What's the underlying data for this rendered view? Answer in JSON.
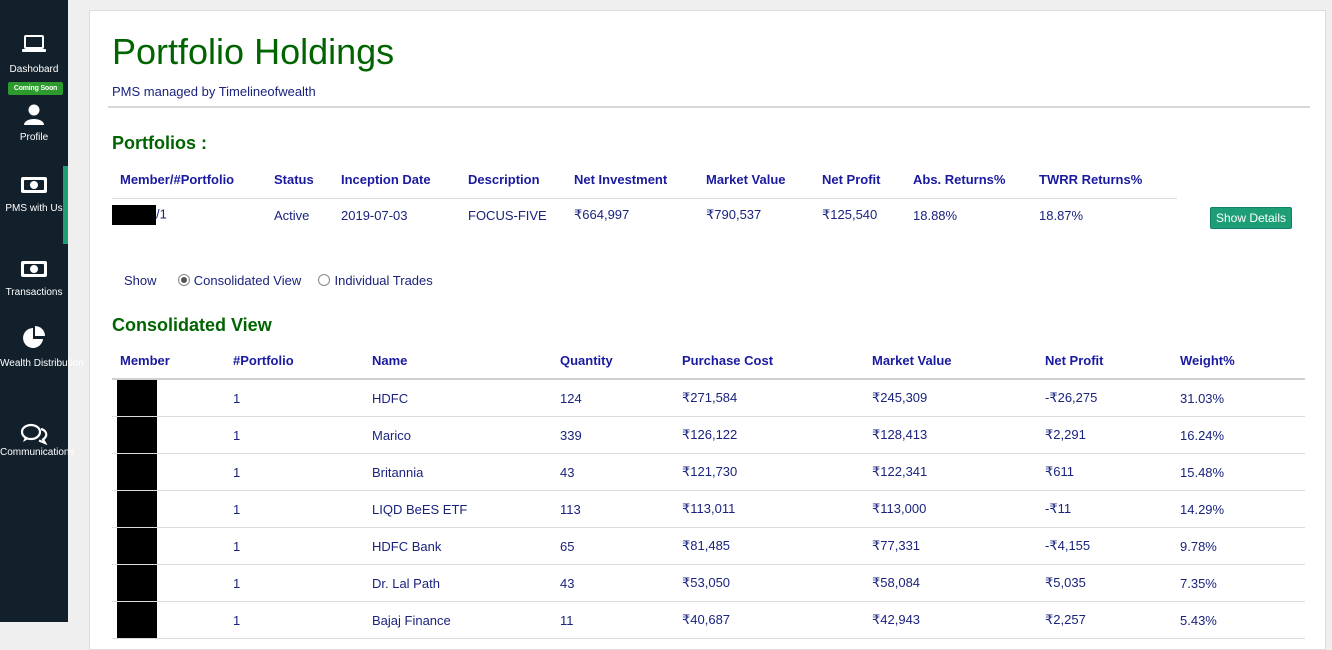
{
  "sidebar": {
    "items": [
      {
        "label": "Dashobard",
        "icon": "laptop-icon"
      },
      {
        "label": "Profile",
        "icon": "user-icon"
      },
      {
        "label": "PMS with Us",
        "icon": "money-icon"
      },
      {
        "label": "Transactions",
        "icon": "money-icon"
      },
      {
        "label": "Wealth Distribution",
        "icon": "pie-chart-icon"
      },
      {
        "label": "Communications",
        "icon": "chat-icon"
      }
    ],
    "badge": "Coming Soon"
  },
  "page": {
    "title": "Portfolio Holdings",
    "subtitle": "PMS managed by Timelineofwealth"
  },
  "portfolios": {
    "heading": "Portfolios :",
    "headers": [
      "Member/#Portfolio",
      "Status",
      "Inception Date",
      "Description",
      "Net Investment",
      "Market Value",
      "Net Profit",
      "Abs. Returns%",
      "TWRR Returns%"
    ],
    "row": {
      "member_suffix": "/1",
      "status": "Active",
      "inception": "2019-07-03",
      "description": "FOCUS-FIVE",
      "net_investment": "₹664,997",
      "market_value": "₹790,537",
      "net_profit": "₹125,540",
      "abs_returns": "18.88%",
      "twrr_returns": "18.87%"
    },
    "button": "Show Details"
  },
  "view_toggle": {
    "label": "Show",
    "options": [
      "Consolidated View",
      "Individual Trades"
    ],
    "selected": "Consolidated View"
  },
  "consolidated": {
    "heading": "Consolidated View",
    "headers": [
      "Member",
      "#Portfolio",
      "Name",
      "Quantity",
      "Purchase Cost",
      "Market Value",
      "Net Profit",
      "Weight%"
    ],
    "rows": [
      {
        "portfolio": "1",
        "name": "HDFC",
        "quantity": "124",
        "cost": "₹271,584",
        "value": "₹245,309",
        "profit": "-₹26,275",
        "weight": "31.03%"
      },
      {
        "portfolio": "1",
        "name": "Marico",
        "quantity": "339",
        "cost": "₹126,122",
        "value": "₹128,413",
        "profit": "₹2,291",
        "weight": "16.24%"
      },
      {
        "portfolio": "1",
        "name": "Britannia",
        "quantity": "43",
        "cost": "₹121,730",
        "value": "₹122,341",
        "profit": "₹611",
        "weight": "15.48%"
      },
      {
        "portfolio": "1",
        "name": "LIQD BeES ETF",
        "quantity": "113",
        "cost": "₹113,011",
        "value": "₹113,000",
        "profit": "-₹11",
        "weight": "14.29%"
      },
      {
        "portfolio": "1",
        "name": "HDFC Bank",
        "quantity": "65",
        "cost": "₹81,485",
        "value": "₹77,331",
        "profit": "-₹4,155",
        "weight": "9.78%"
      },
      {
        "portfolio": "1",
        "name": "Dr. Lal Path",
        "quantity": "43",
        "cost": "₹53,050",
        "value": "₹58,084",
        "profit": "₹5,035",
        "weight": "7.35%"
      },
      {
        "portfolio": "1",
        "name": "Bajaj Finance",
        "quantity": "11",
        "cost": "₹40,687",
        "value": "₹42,943",
        "profit": "₹2,257",
        "weight": "5.43%"
      }
    ]
  },
  "colors": {
    "accent": "#1e9e77",
    "title": "#006400",
    "text": "#1a237e",
    "sidebar": "#12202c"
  }
}
